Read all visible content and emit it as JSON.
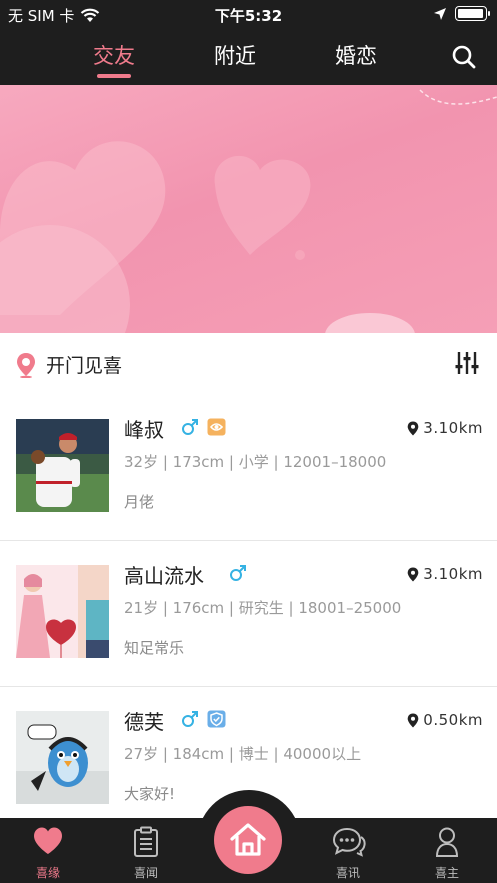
{
  "status_bar": {
    "carrier": "无 SIM 卡",
    "time": "下午5:32",
    "battery_level": 0.95,
    "icons": [
      "wifi-icon",
      "location-arrow-icon",
      "battery-icon"
    ]
  },
  "top_nav": {
    "tabs": [
      {
        "label": "交友",
        "active": true
      },
      {
        "label": "附近",
        "active": false
      },
      {
        "label": "婚恋",
        "active": false
      }
    ],
    "search_icon": "search-icon",
    "accent_color": "#f07b8c"
  },
  "banner": {
    "background_color": "#f294af",
    "decoration": "heart-balloons"
  },
  "section": {
    "title": "开门见喜",
    "pin_icon": "location-pin-icon",
    "filter_icon": "filter-sliders-icon"
  },
  "users": [
    {
      "name": "峰叔",
      "gender": "male",
      "gender_icon": "male-icon",
      "badge_icon": "orange-badge-icon",
      "distance": "3.10km",
      "info": "32岁 | 173cm | 小学 | 12001–18000",
      "bio": "月佬",
      "avatar": "baseball-player-photo"
    },
    {
      "name": "高山流水",
      "gender": "male",
      "gender_icon": "male-icon",
      "badge_icon": null,
      "distance": "3.10km",
      "info": "21岁 | 176cm | 研究生 | 18001–25000",
      "bio": "知足常乐",
      "avatar": "couple-illustration"
    },
    {
      "name": "德芙",
      "gender": "male",
      "gender_icon": "male-icon",
      "badge_icon": "verified-shield-icon",
      "distance": "0.50km",
      "info": "27岁 | 184cm | 博士 | 40000以上",
      "bio": "大家好!",
      "avatar": "bird-cartoon-photo"
    }
  ],
  "bottom_bar": {
    "items": [
      {
        "label": "喜缘",
        "icon": "heart-icon",
        "active": true
      },
      {
        "label": "喜闻",
        "icon": "clipboard-icon",
        "active": false
      },
      {
        "label": "",
        "icon": "home-icon",
        "active": false
      },
      {
        "label": "喜讯",
        "icon": "chat-bubbles-icon",
        "active": false
      },
      {
        "label": "喜主",
        "icon": "person-icon",
        "active": false
      }
    ]
  }
}
